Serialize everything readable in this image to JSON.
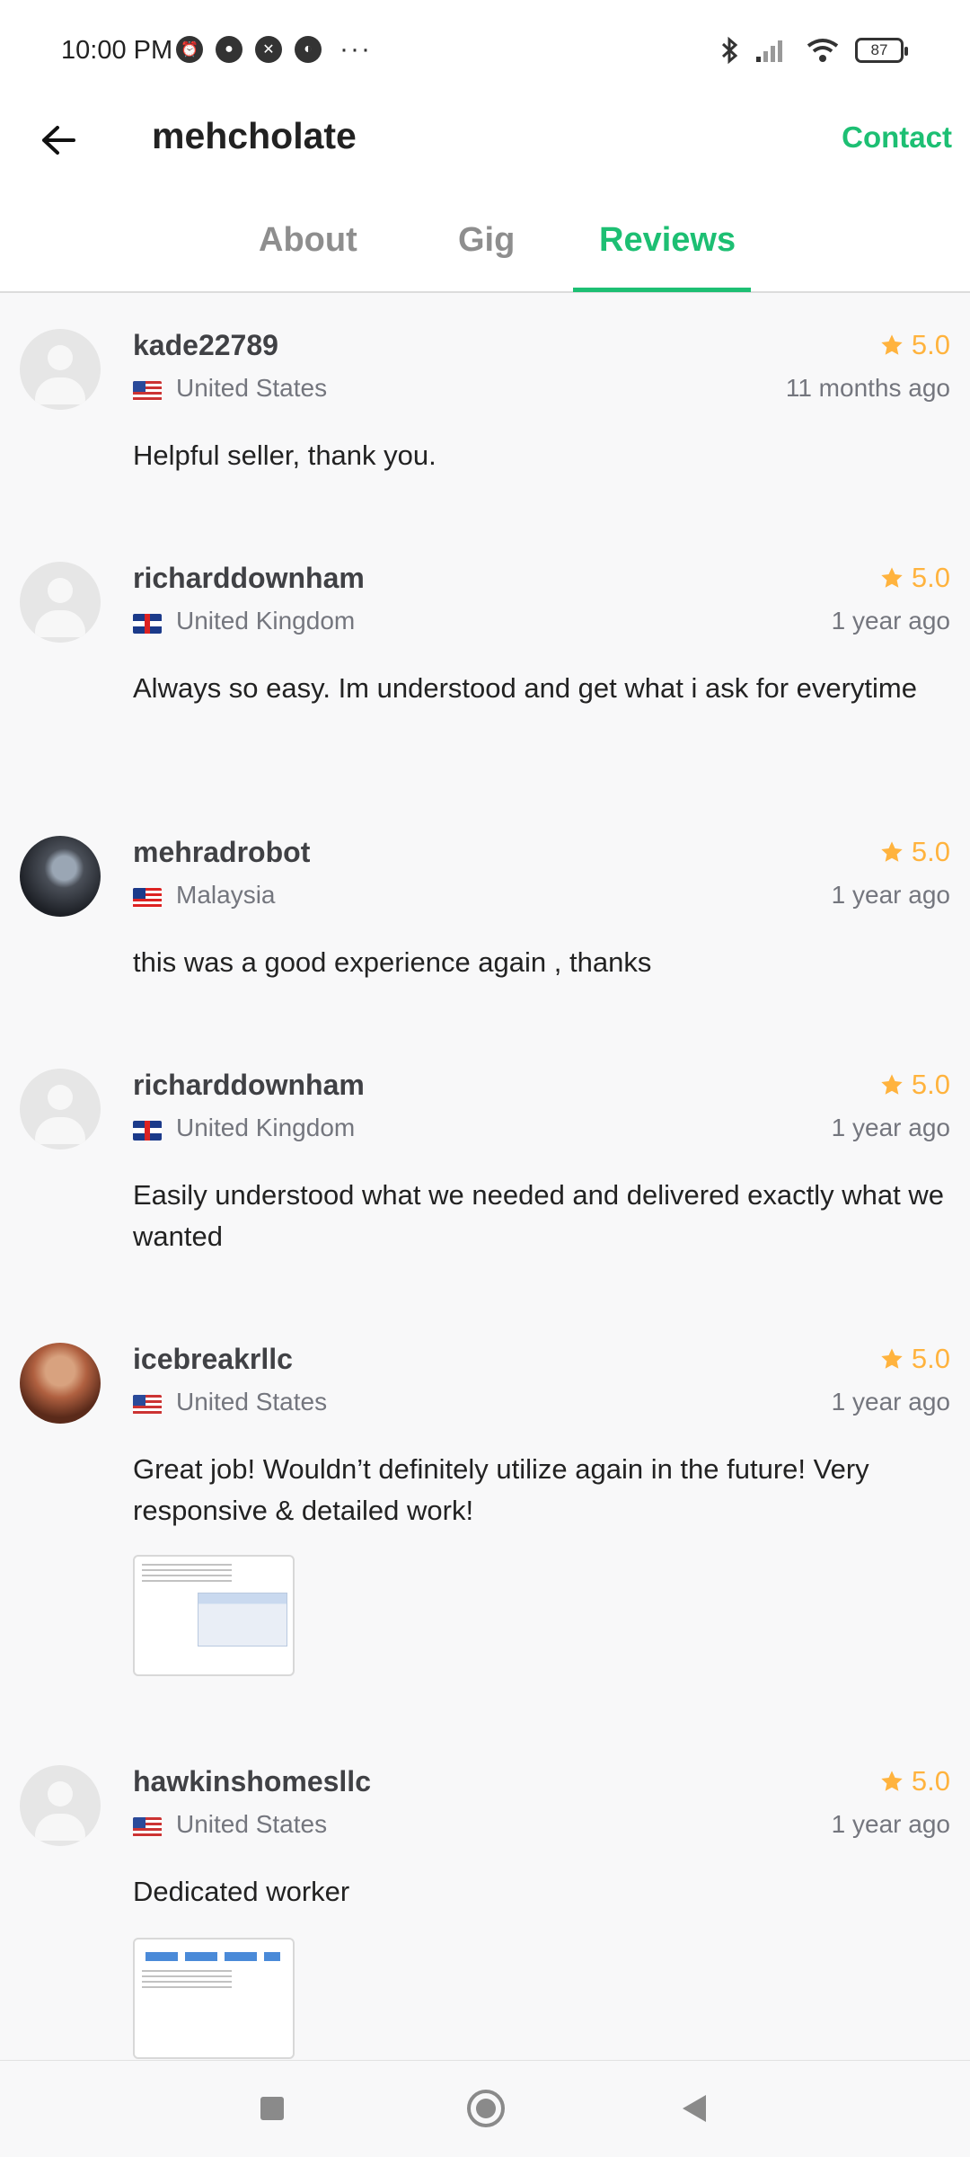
{
  "status_bar": {
    "time": "10:00 PM",
    "more": "···",
    "battery": "87"
  },
  "header": {
    "title": "mehcholate",
    "contact_label": "Contact"
  },
  "tabs": [
    {
      "label": "About",
      "active": false
    },
    {
      "label": "Gig",
      "active": false
    },
    {
      "label": "Reviews",
      "active": true
    }
  ],
  "colors": {
    "accent": "#1dbf73",
    "star": "#ffb33e"
  },
  "reviews": [
    {
      "username": "kade22789",
      "rating": "5.0",
      "country": "United States",
      "time_ago": "11 months ago",
      "comment": "Helpful seller, thank you."
    },
    {
      "username": "richarddownham",
      "rating": "5.0",
      "country": "United Kingdom",
      "time_ago": "1 year ago",
      "comment": "Always so easy. Im understood and get what i ask for everytime"
    },
    {
      "username": "mehradrobot",
      "rating": "5.0",
      "country": "Malaysia",
      "time_ago": "1 year ago",
      "comment": "this was a good experience again , thanks"
    },
    {
      "username": "richarddownham",
      "rating": "5.0",
      "country": "United Kingdom",
      "time_ago": "1 year ago",
      "comment": "Easily understood what we needed and delivered exactly what we wanted"
    },
    {
      "username": "icebreakrllc",
      "rating": "5.0",
      "country": "United States",
      "time_ago": "1 year ago",
      "comment": "Great job! Wouldn’t definitely utilize again in the future! Very responsive & detailed work!"
    },
    {
      "username": "hawkinshomesllc",
      "rating": "5.0",
      "country": "United States",
      "time_ago": "1 year ago",
      "comment": "Dedicated worker"
    }
  ]
}
